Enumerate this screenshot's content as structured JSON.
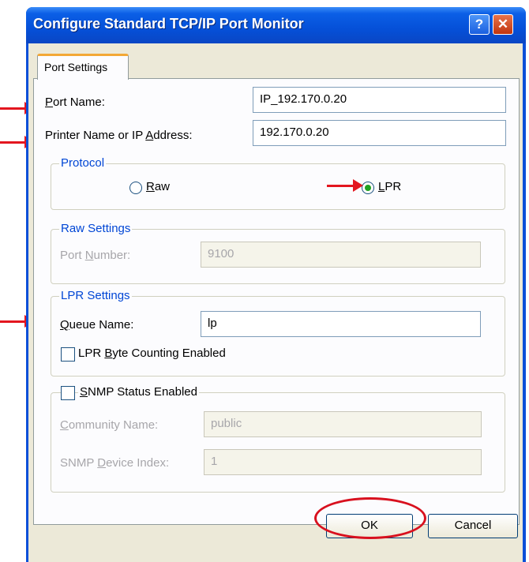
{
  "window": {
    "title": "Configure Standard TCP/IP Port Monitor",
    "help_label": "?",
    "close_label": "✕"
  },
  "tabs": [
    {
      "label": "Port Settings",
      "active": true
    }
  ],
  "port_name": {
    "label_key": "P",
    "label_rest": "ort Name:",
    "value": "IP_192.170.0.20"
  },
  "printer_address": {
    "label_pre": "Printer Name or IP ",
    "label_key": "A",
    "label_post": "ddress:",
    "value": "192.170.0.20"
  },
  "protocol": {
    "title": "Protocol",
    "raw": {
      "key": "R",
      "rest": "aw",
      "selected": false
    },
    "lpr": {
      "key": "L",
      "rest": "PR",
      "selected": true
    }
  },
  "raw_settings": {
    "title": "Raw Settings",
    "port_number": {
      "label_pre": "Port ",
      "label_key": "N",
      "label_post": "umber:",
      "value": "9100",
      "enabled": false
    }
  },
  "lpr_settings": {
    "title": "LPR Settings",
    "queue_name": {
      "label_key": "Q",
      "label_rest": "ueue Name:",
      "value": "lp"
    },
    "byte_counting": {
      "label_pre": "LPR ",
      "label_key": "B",
      "label_post": "yte Counting Enabled",
      "checked": false
    }
  },
  "snmp": {
    "status": {
      "label_key": "S",
      "label_rest": "NMP Status Enabled",
      "checked": false
    },
    "community": {
      "label_key": "C",
      "label_rest": "ommunity Name:",
      "value": "public",
      "enabled": false
    },
    "device_index": {
      "label_pre": "SNMP ",
      "label_key": "D",
      "label_post": "evice Index:",
      "value": "1",
      "enabled": false
    }
  },
  "buttons": {
    "ok": "OK",
    "cancel": "Cancel"
  },
  "annotation": {
    "color": "#e3161f"
  }
}
